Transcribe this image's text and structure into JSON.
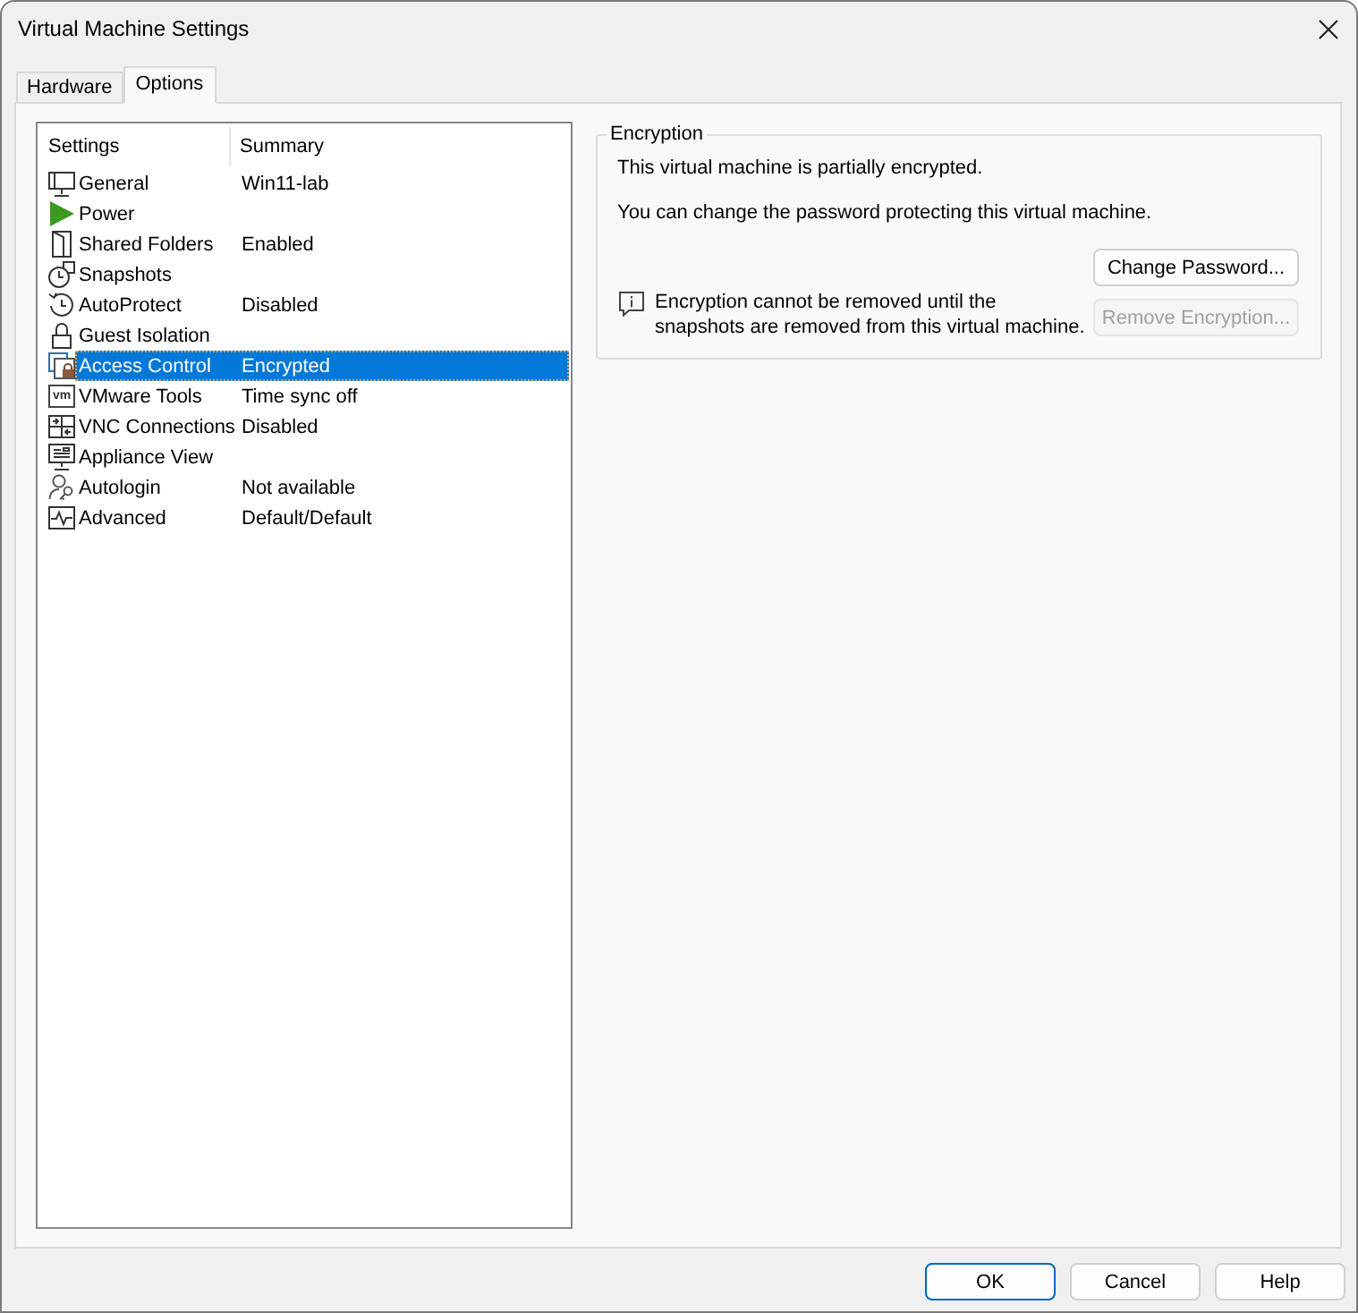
{
  "window": {
    "title": "Virtual Machine Settings"
  },
  "tabs": [
    {
      "label": "Hardware",
      "selected": false
    },
    {
      "label": "Options",
      "selected": true
    }
  ],
  "settings": {
    "columns": [
      "Settings",
      "Summary"
    ],
    "items": [
      {
        "name": "General",
        "summary": "Win11-lab",
        "selected": false
      },
      {
        "name": "Power",
        "selected": false
      },
      {
        "name": "Shared Folders",
        "summary": "Enabled",
        "selected": false
      },
      {
        "name": "Snapshots",
        "selected": false
      },
      {
        "name": "AutoProtect",
        "summary": "Disabled",
        "selected": false
      },
      {
        "name": "Guest Isolation",
        "selected": false
      },
      {
        "name": "Access Control",
        "summary": "Encrypted",
        "selected": true
      },
      {
        "name": "VMware Tools",
        "summary": "Time sync off",
        "selected": false,
        "icon_text": "vm"
      },
      {
        "name": "VNC Connections",
        "summary": "Disabled",
        "selected": false
      },
      {
        "name": "Appliance View",
        "selected": false
      },
      {
        "name": "Autologin",
        "summary": "Not available",
        "selected": false
      },
      {
        "name": "Advanced",
        "summary": "Default/Default",
        "selected": false
      }
    ]
  },
  "encryption": {
    "title": "Encryption",
    "status": "This virtual machine is partially encrypted.",
    "password_note": "You can change the password protecting this virtual machine.",
    "notice": "Encryption cannot be removed until the\nsnapshots are removed from this virtual machine.",
    "buttons": [
      {
        "label": "Change Password...",
        "disabled": false
      },
      {
        "label": "Remove Encryption...",
        "disabled": true
      }
    ]
  },
  "footer_buttons": [
    {
      "label": "OK",
      "default": true
    },
    {
      "label": "Cancel",
      "default": false
    },
    {
      "label": "Help",
      "default": false
    }
  ]
}
